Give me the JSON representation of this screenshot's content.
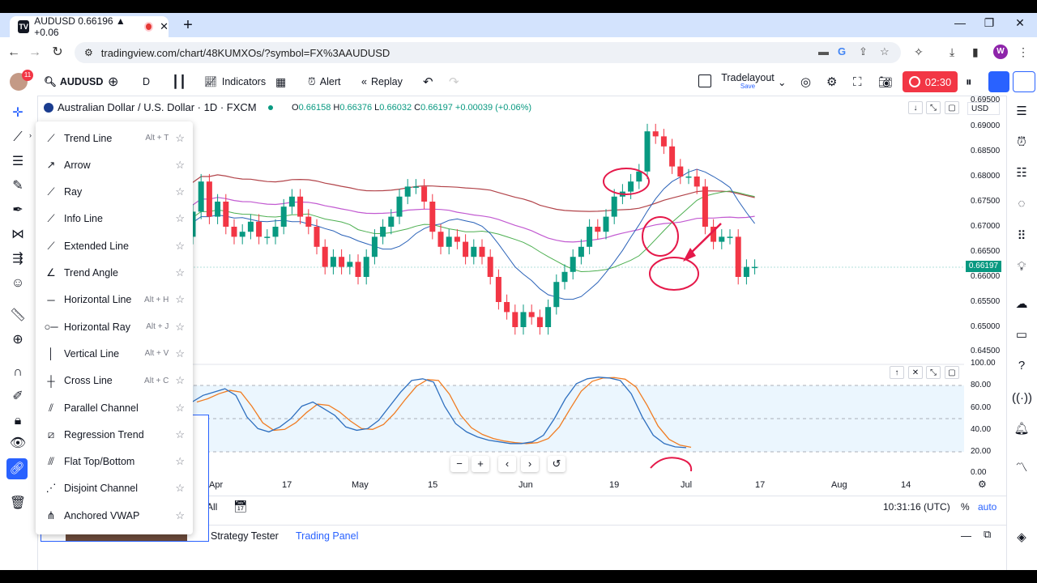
{
  "browser": {
    "tab_title": "AUDUSD 0.66196 ▲ +0.06",
    "tab_fav_text": "TV",
    "url": "tradingview.com/chart/48KUMXOs/?symbol=FX%3AAUDUSD",
    "profile_initial": "W"
  },
  "topbar": {
    "notif_count": "11",
    "symbol": "AUDUSD",
    "interval": "D",
    "indicators_label": "Indicators",
    "alert_label": "Alert",
    "replay_label": "Replay",
    "layout_name": "Tradelayout",
    "layout_status": "Save",
    "record_time": "02:30"
  },
  "chart": {
    "title": "Australian Dollar / U.S. Dollar · 1D · FXCM",
    "ohlc": {
      "o_label": "O",
      "o": "0.66158",
      "h_label": "H",
      "h": "0.66376",
      "l_label": "L",
      "l": "0.66032",
      "c_label": "C",
      "c": "0.66197",
      "change": "+0.00039 (+0.06%)"
    },
    "currency": "USD",
    "current_price": "0.66197",
    "price_axis": [
      "0.69500",
      "0.69000",
      "0.68500",
      "0.68000",
      "0.67500",
      "0.67000",
      "0.66500",
      "0.66000",
      "0.65500",
      "0.65000",
      "0.64500"
    ],
    "osc_axis": [
      "100.00",
      "80.00",
      "60.00",
      "40.00",
      "20.00",
      "0.00"
    ],
    "time_axis": [
      "Apr",
      "17",
      "May",
      "15",
      "Jun",
      "19",
      "Jul",
      "17",
      "Aug",
      "14"
    ],
    "clock": "10:31:16 (UTC)",
    "pct_label": "%",
    "auto_label": "auto",
    "range_all": "All"
  },
  "bottom_panel": {
    "strategy_tester": "Strategy Tester",
    "trading_panel": "Trading Panel"
  },
  "line_tools_menu": [
    {
      "label": "Trend Line",
      "shortcut": "Alt + T",
      "icon": "trend-line-icon"
    },
    {
      "label": "Arrow",
      "shortcut": "",
      "icon": "arrow-icon"
    },
    {
      "label": "Ray",
      "shortcut": "",
      "icon": "ray-icon"
    },
    {
      "label": "Info Line",
      "shortcut": "",
      "icon": "info-line-icon"
    },
    {
      "label": "Extended Line",
      "shortcut": "",
      "icon": "extended-line-icon"
    },
    {
      "label": "Trend Angle",
      "shortcut": "",
      "icon": "trend-angle-icon"
    },
    {
      "label": "Horizontal Line",
      "shortcut": "Alt + H",
      "icon": "horizontal-line-icon"
    },
    {
      "label": "Horizontal Ray",
      "shortcut": "Alt + J",
      "icon": "horizontal-ray-icon"
    },
    {
      "label": "Vertical Line",
      "shortcut": "Alt + V",
      "icon": "vertical-line-icon"
    },
    {
      "label": "Cross Line",
      "shortcut": "Alt + C",
      "icon": "cross-line-icon"
    },
    {
      "label": "Parallel Channel",
      "shortcut": "",
      "icon": "parallel-channel-icon"
    },
    {
      "label": "Regression Trend",
      "shortcut": "",
      "icon": "regression-trend-icon"
    },
    {
      "label": "Flat Top/Bottom",
      "shortcut": "",
      "icon": "flat-top-bottom-icon"
    },
    {
      "label": "Disjoint Channel",
      "shortcut": "",
      "icon": "disjoint-channel-icon"
    },
    {
      "label": "Anchored VWAP",
      "shortcut": "",
      "icon": "anchored-vwap-icon"
    }
  ],
  "colors": {
    "up": "#089981",
    "down": "#f23645",
    "accent": "#2962ff",
    "annotation": "#e5194a",
    "ma_red": "#b2444a",
    "ma_purple": "#c25ad1",
    "ma_green": "#4caf50",
    "ma_blue": "#2a62b8",
    "stoch_k": "#2e6fbf",
    "stoch_d": "#f07c22"
  },
  "chart_data": {
    "type": "candlestick",
    "candles_close_approx": [
      0.668,
      0.675,
      0.672,
      0.669,
      0.668,
      0.673,
      0.679,
      0.672,
      0.675,
      0.67,
      0.668,
      0.669,
      0.671,
      0.668,
      0.668,
      0.67,
      0.674,
      0.676,
      0.672,
      0.67,
      0.666,
      0.662,
      0.664,
      0.662,
      0.663,
      0.66,
      0.664,
      0.668,
      0.67,
      0.672,
      0.676,
      0.678,
      0.678,
      0.675,
      0.669,
      0.666,
      0.668,
      0.667,
      0.664,
      0.666,
      0.664,
      0.66,
      0.655,
      0.653,
      0.65,
      0.653,
      0.652,
      0.65,
      0.654,
      0.659,
      0.661,
      0.664,
      0.666,
      0.67,
      0.669,
      0.672,
      0.676,
      0.677,
      0.679,
      0.681,
      0.689,
      0.688,
      0.686,
      0.682,
      0.68,
      0.68,
      0.678,
      0.67,
      0.667,
      0.668,
      0.668,
      0.66,
      0.662,
      0.662
    ],
    "stochastic_k": [
      60,
      68,
      72,
      76,
      68,
      42,
      28,
      24,
      30,
      40,
      55,
      60,
      52,
      44,
      30,
      26,
      28,
      38,
      55,
      72,
      86,
      88,
      84,
      55,
      34,
      24,
      18,
      14,
      12,
      10,
      10,
      12,
      20,
      40,
      64,
      82,
      88,
      90,
      89,
      86,
      70,
      42,
      20,
      10,
      6,
      5
    ],
    "overbought": 80,
    "oversold": 20
  }
}
